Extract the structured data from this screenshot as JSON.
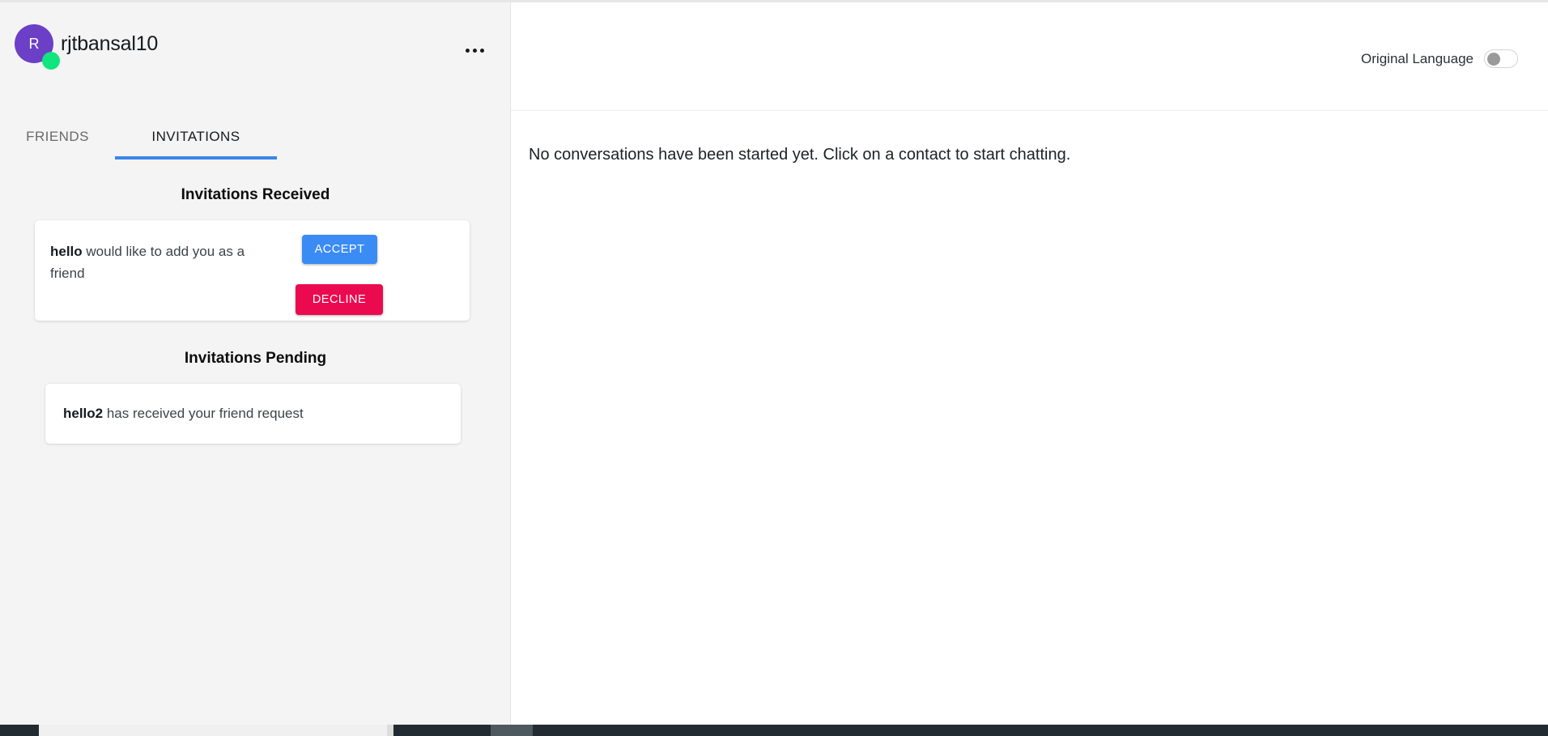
{
  "sidebar": {
    "profile": {
      "avatar_initial": "R",
      "username": "rjtbansal10",
      "avatar_color": "#6b3fc6",
      "presence_status": "online",
      "presence_color": "#11e57d"
    },
    "more_menu_icon": "ellipsis-icon",
    "tabs": [
      {
        "label": "FRIENDS",
        "active": false
      },
      {
        "label": "INVITATIONS",
        "active": true
      }
    ],
    "sections": [
      {
        "title": "Invitations Received",
        "cards": [
          {
            "sender": "hello",
            "message": " would like to add you as a friend",
            "accept_label": "ACCEPT",
            "decline_label": "DECLINE",
            "accept_color": "#3b8bf5",
            "decline_color": "#eb0a50"
          }
        ]
      },
      {
        "title": "Invitations Pending",
        "cards": [
          {
            "recipient": "hello2",
            "message": " has received your friend request"
          }
        ]
      }
    ]
  },
  "main": {
    "header": {
      "language_toggle_label": "Original Language",
      "language_toggle_on": false
    },
    "empty_state_message": "No conversations have been started yet. Click on a contact to start chatting."
  },
  "theme": {
    "accent_blue": "#3b86e8",
    "sidebar_bg": "#f4f4f4",
    "divider": "#e2e2e4"
  }
}
